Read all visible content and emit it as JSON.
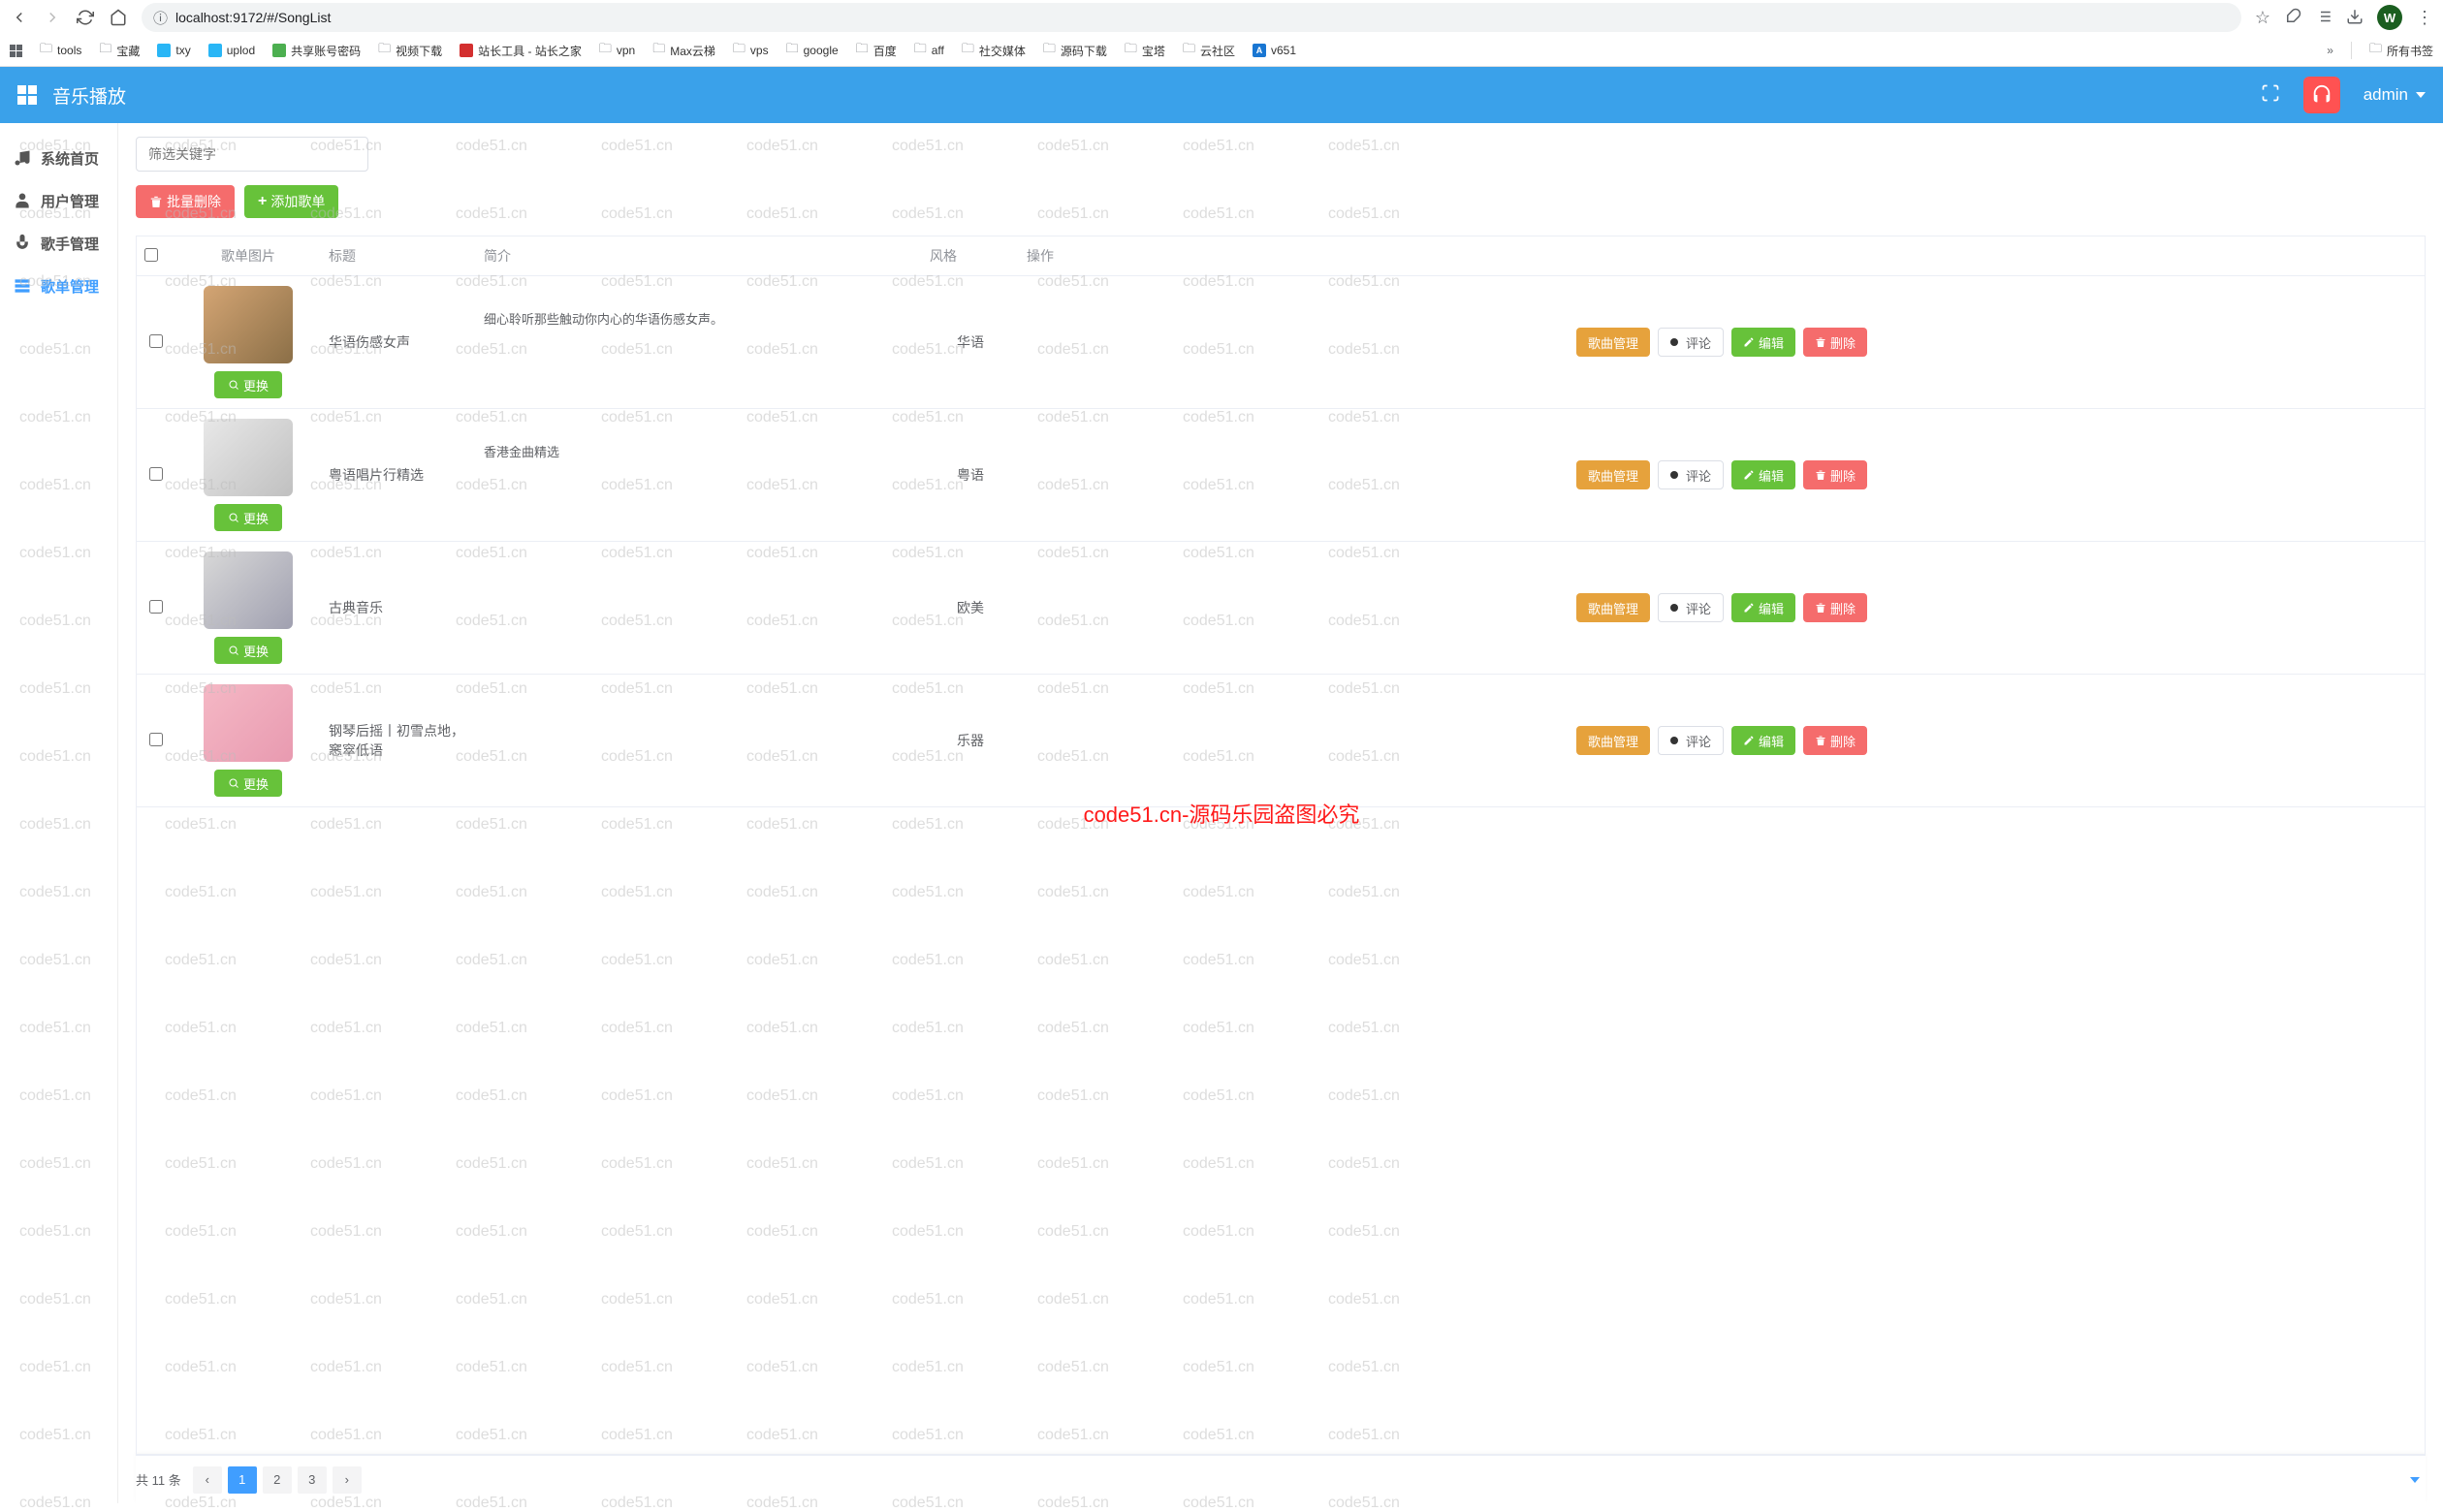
{
  "browser": {
    "url": "localhost:9172/#/SongList",
    "avatar_letter": "W",
    "bookmarks": [
      {
        "icon": "grid",
        "label": ""
      },
      {
        "icon": "folder",
        "label": "tools"
      },
      {
        "icon": "folder",
        "label": "宝藏"
      },
      {
        "icon": "cyan",
        "label": "txy"
      },
      {
        "icon": "cyan",
        "label": "uplod"
      },
      {
        "icon": "green",
        "label": "共享账号密码"
      },
      {
        "icon": "folder",
        "label": "视频下载"
      },
      {
        "icon": "red",
        "label": "站长工具 - 站长之家"
      },
      {
        "icon": "folder",
        "label": "vpn"
      },
      {
        "icon": "folder",
        "label": "Max云梯"
      },
      {
        "icon": "folder",
        "label": "vps"
      },
      {
        "icon": "folder",
        "label": "google"
      },
      {
        "icon": "folder",
        "label": "百度"
      },
      {
        "icon": "folder",
        "label": "aff"
      },
      {
        "icon": "folder",
        "label": "社交媒体"
      },
      {
        "icon": "folder",
        "label": "源码下载"
      },
      {
        "icon": "folder",
        "label": "宝塔"
      },
      {
        "icon": "folder",
        "label": "云社区"
      },
      {
        "icon": "blueb",
        "label": "v651"
      }
    ],
    "all_bookmarks_label": "所有书签"
  },
  "header": {
    "title": "音乐播放",
    "user": "admin"
  },
  "sidebar": {
    "items": [
      {
        "label": "系统首页",
        "icon": "home"
      },
      {
        "label": "用户管理",
        "icon": "user"
      },
      {
        "label": "歌手管理",
        "icon": "mic"
      },
      {
        "label": "歌单管理",
        "icon": "list",
        "active": true
      }
    ]
  },
  "toolbar": {
    "filter_placeholder": "筛选关键字",
    "batch_delete": "批量删除",
    "add_songlist": "添加歌单"
  },
  "table": {
    "headers": {
      "image": "歌单图片",
      "title": "标题",
      "desc": "简介",
      "style": "风格",
      "ops": "操作"
    },
    "change_label": "更换",
    "ops_labels": {
      "song_manage": "歌曲管理",
      "comment": "评论",
      "edit": "编辑",
      "delete": "删除"
    },
    "rows": [
      {
        "cover": "c1",
        "title": "华语伤感女声",
        "desc": "细心聆听那些触动你内心的华语伤感女声。",
        "style": "华语"
      },
      {
        "cover": "c2",
        "title": "粤语唱片行精选",
        "desc": "香港金曲精选",
        "style": "粤语"
      },
      {
        "cover": "c3",
        "title": "古典音乐",
        "desc": "",
        "style": "欧美"
      },
      {
        "cover": "c4",
        "title": "钢琴后摇丨初雪点地，窸窣低语",
        "desc": "",
        "style": "乐器"
      }
    ]
  },
  "pagination": {
    "total_text": "共 11 条",
    "pages": [
      "1",
      "2",
      "3"
    ],
    "active": "1"
  },
  "watermark": {
    "text": "code51.cn",
    "center": "code51.cn-源码乐园盗图必究"
  }
}
